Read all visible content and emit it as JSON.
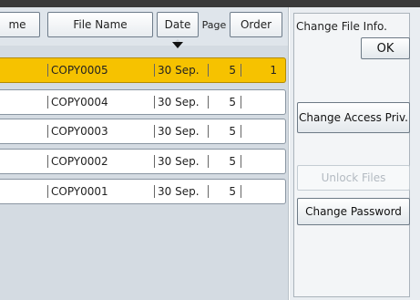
{
  "header": {
    "name_label": "me",
    "file_name_label": "File Name",
    "date_label": "Date",
    "page_label": "Page",
    "order_label": "Order"
  },
  "files": [
    {
      "file": "COPY0005",
      "date": "30 Sep.",
      "page": "5",
      "order": "1",
      "selected": true
    },
    {
      "file": "COPY0004",
      "date": "30 Sep.",
      "page": "5",
      "order": ""
    },
    {
      "file": "COPY0003",
      "date": "30 Sep.",
      "page": "5",
      "order": ""
    },
    {
      "file": "COPY0002",
      "date": "30 Sep.",
      "page": "5",
      "order": ""
    },
    {
      "file": "COPY0001",
      "date": "30 Sep.",
      "page": "5",
      "order": ""
    }
  ],
  "panel": {
    "title": "Change File Info.",
    "ok_label": "OK",
    "change_access_label": "Change Access Priv.",
    "unlock_label": "Unlock Files",
    "change_password_label": "Change Password"
  },
  "colors": {
    "selected_row": "#f6c200",
    "panel_bg": "#e9edf1"
  }
}
